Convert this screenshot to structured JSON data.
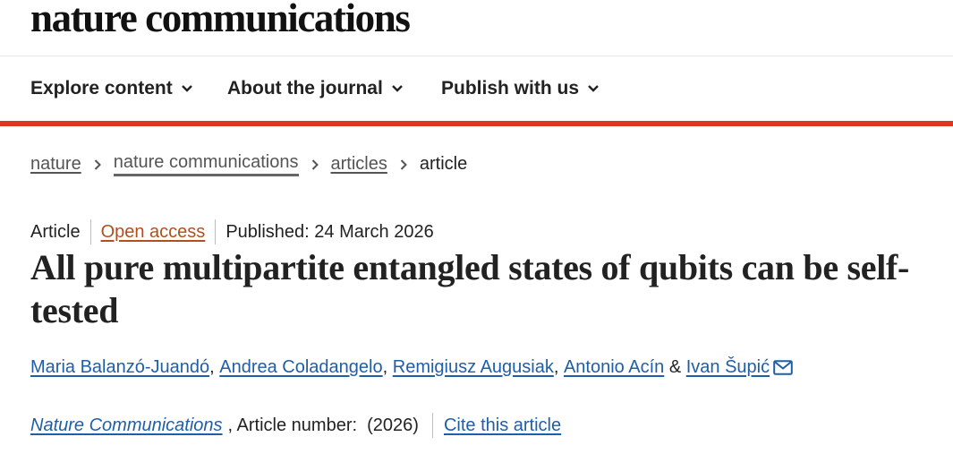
{
  "header": {
    "logo_text": "nature communications"
  },
  "nav": {
    "items": [
      {
        "label": "Explore content"
      },
      {
        "label": "About the journal"
      },
      {
        "label": "Publish with us"
      }
    ]
  },
  "breadcrumb": {
    "items": [
      "nature",
      "nature communications",
      "articles"
    ],
    "current": "article"
  },
  "article": {
    "type": "Article",
    "access": "Open access",
    "published": "Published: 24 March 2026",
    "title": "All pure multipartite entangled states of qubits can be self-tested",
    "authors": [
      "Maria Balanzó-Juandó",
      "Andrea Coladangelo",
      "Remigiusz Augusiak",
      "Antonio Acín",
      "Ivan Šupić"
    ],
    "journal": "Nature Communications",
    "article_number_text": ", Article number:  (2026)",
    "cite_label": "Cite this article"
  },
  "colors": {
    "accent_bar": "#e0351f",
    "link": "#1f5ea8",
    "open_access": "#b0501f"
  },
  "icons": {
    "nav_chevron": "chevron-down-icon",
    "breadcrumb_separator": "chevron-right-icon",
    "corresponding_author": "mail-icon"
  }
}
